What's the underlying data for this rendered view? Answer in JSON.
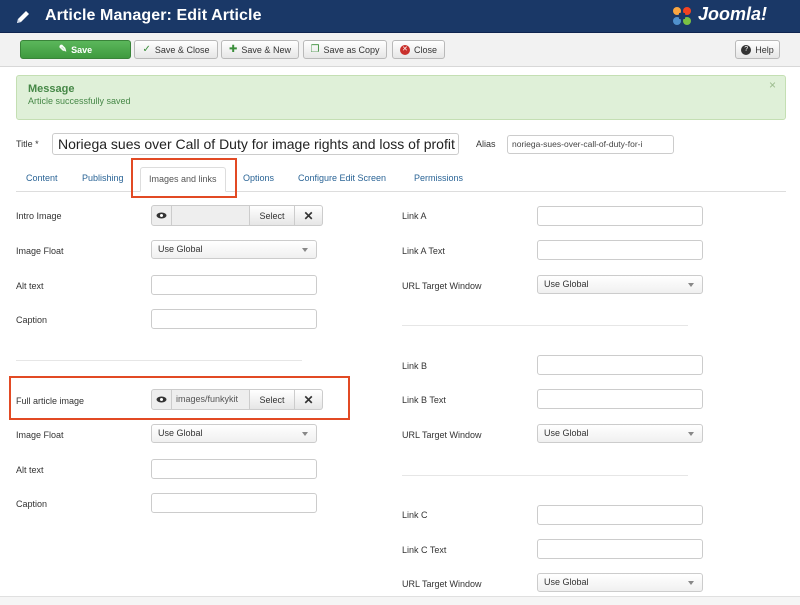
{
  "header": {
    "title": "Article Manager: Edit Article",
    "logo": "Joomla!"
  },
  "toolbar": {
    "save": "Save",
    "save_close": "Save & Close",
    "save_new": "Save & New",
    "save_copy": "Save as Copy",
    "close": "Close",
    "help": "Help"
  },
  "message": {
    "heading": "Message",
    "text": "Article successfully saved",
    "close": "×"
  },
  "title": {
    "label": "Title *",
    "value": "Noriega sues over Call of Duty for image rights and loss of profit"
  },
  "alias": {
    "label": "Alias",
    "value": "noriega-sues-over-call-of-duty-for-i"
  },
  "tabs": [
    "Content",
    "Publishing",
    "Images and links",
    "Options",
    "Configure Edit Screen",
    "Permissions"
  ],
  "images": {
    "intro_image": {
      "label": "Intro Image",
      "path": "",
      "select": "Select"
    },
    "intro_float": {
      "label": "Image Float",
      "value": "Use Global"
    },
    "intro_alt": {
      "label": "Alt text",
      "value": ""
    },
    "intro_caption": {
      "label": "Caption",
      "value": ""
    },
    "full_image": {
      "label": "Full article image",
      "path": "images/funkykit",
      "select": "Select"
    },
    "full_float": {
      "label": "Image Float",
      "value": "Use Global"
    },
    "full_alt": {
      "label": "Alt text",
      "value": ""
    },
    "full_caption": {
      "label": "Caption",
      "value": ""
    }
  },
  "links": {
    "a": {
      "label": "Link A",
      "text_label": "Link A Text",
      "target_label": "URL Target Window",
      "target": "Use Global"
    },
    "b": {
      "label": "Link B",
      "text_label": "Link B Text",
      "target_label": "URL Target Window",
      "target": "Use Global"
    },
    "c": {
      "label": "Link C",
      "text_label": "Link C Text",
      "target_label": "URL Target Window",
      "target": "Use Global"
    }
  },
  "colors": {
    "header_bg": "#1a3867",
    "save_green": "#4cae4c",
    "alert_bg": "#dff0d8",
    "highlight": "#e24a24",
    "link": "#2a6496"
  },
  "icons": [
    "pencil-icon",
    "joomla-logo",
    "save-icon",
    "check-icon",
    "plus-icon",
    "copy-icon",
    "close-icon",
    "help-icon",
    "eye-icon",
    "clear-icon"
  ]
}
